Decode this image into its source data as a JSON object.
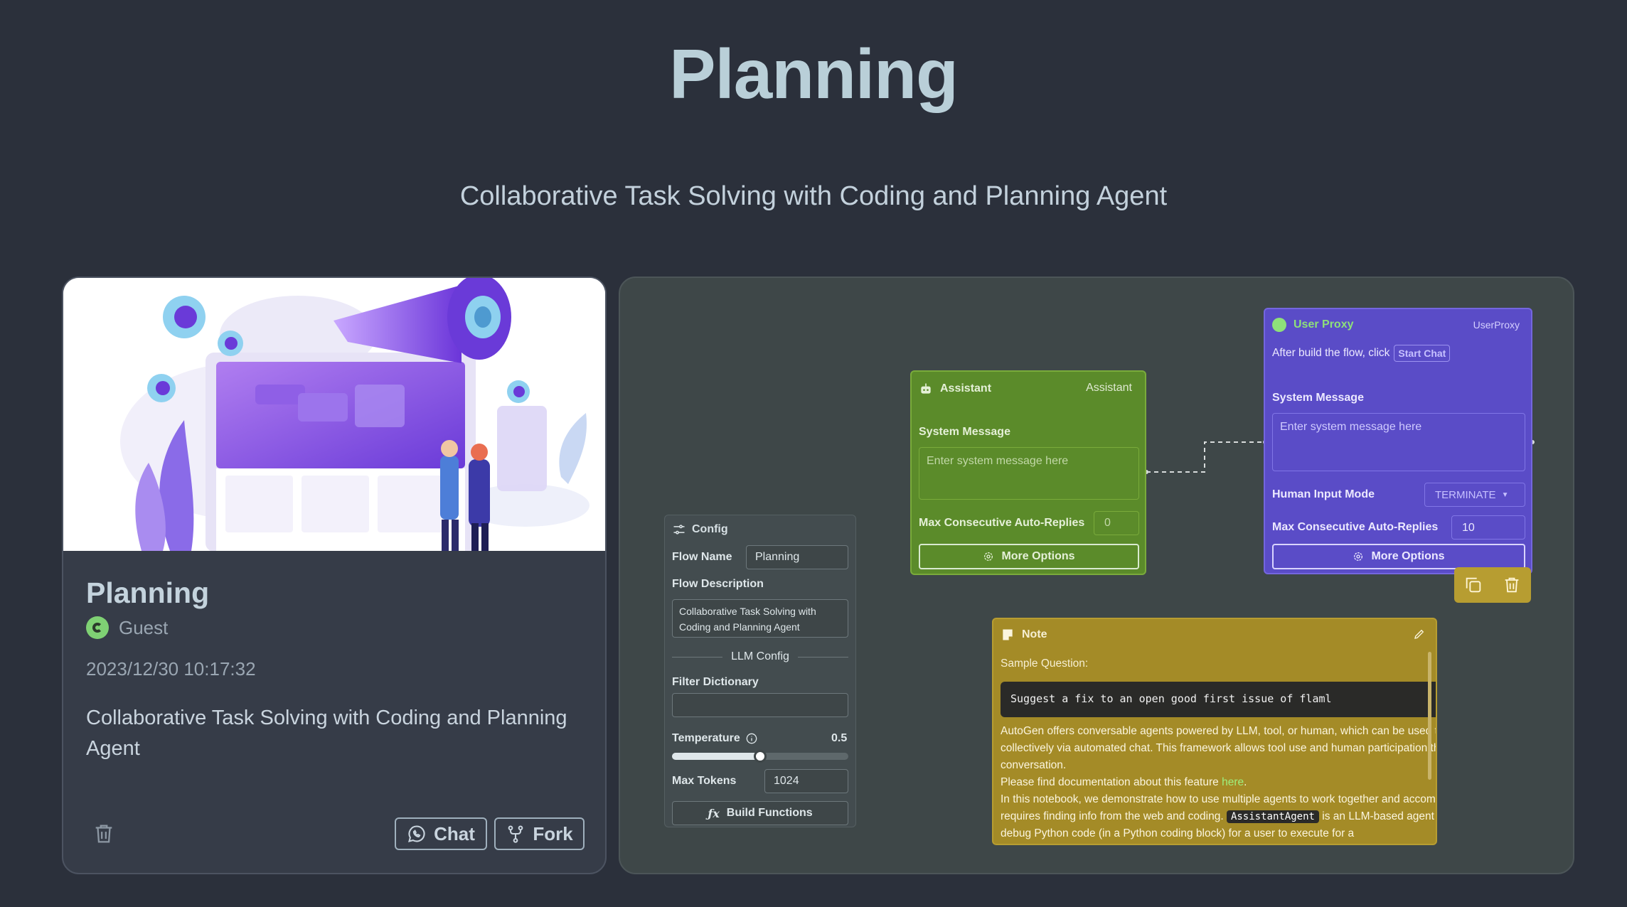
{
  "page": {
    "title": "Planning",
    "subtitle": "Collaborative Task Solving with Coding and Planning Agent"
  },
  "card": {
    "title": "Planning",
    "user": "Guest",
    "date": "2023/12/30 10:17:32",
    "description": "Collaborative Task Solving with Coding and Planning Agent",
    "chat_label": "Chat",
    "fork_label": "Fork"
  },
  "config": {
    "header": "Config",
    "flow_name_label": "Flow Name",
    "flow_name_value": "Planning",
    "flow_desc_label": "Flow Description",
    "flow_desc_value": "Collaborative Task Solving with Coding and Planning Agent",
    "llm_config_label": "LLM Config",
    "filter_dict_label": "Filter Dictionary",
    "temperature_label": "Temperature",
    "temperature_value": "0.5",
    "temperature_fraction": 0.5,
    "max_tokens_label": "Max Tokens",
    "max_tokens_value": "1024",
    "build_functions_label": "Build Functions"
  },
  "assistant": {
    "title": "Assistant",
    "type": "Assistant",
    "system_message_label": "System Message",
    "system_message_placeholder": "Enter system message here",
    "max_replies_label": "Max Consecutive Auto-Replies",
    "max_replies_value": "0",
    "more_options_label": "More Options"
  },
  "user_proxy": {
    "title": "User Proxy",
    "type": "UserProxy",
    "hint": "After build the flow, click",
    "start_chat_label": "Start Chat",
    "system_message_label": "System Message",
    "system_message_placeholder": "Enter system message here",
    "human_input_label": "Human Input Mode",
    "human_input_value": "TERMINATE",
    "max_replies_label": "Max Consecutive Auto-Replies",
    "max_replies_value": "10",
    "more_options_label": "More Options"
  },
  "note": {
    "title": "Note",
    "sample_label": "Sample Question:",
    "code": "Suggest a fix to an open good first issue of flaml",
    "para1": "AutoGen offers conversable agents powered by LLM, tool, or human, which can be used to perform tasks collectively via automated chat. This framework allows tool use and human participation through multi-agent conversation.",
    "para1_line2": "Please find documentation about this feature",
    "link_text": "here",
    "para2_start": "In this notebook, we demonstrate how to use multiple agents to work together and accomplish a task that requires finding info from the web and coding.",
    "inline_code": "AssistantAgent",
    "para2_end": "is an LLM-based agent that can write and debug Python code (in a Python coding block) for a user to execute for a"
  },
  "colors": {
    "background": "#2b303b",
    "assistant_node": "#5b8b2a",
    "user_proxy_node": "#5a4cc7",
    "note_node": "#a48b27",
    "link": "#9ef07e"
  }
}
